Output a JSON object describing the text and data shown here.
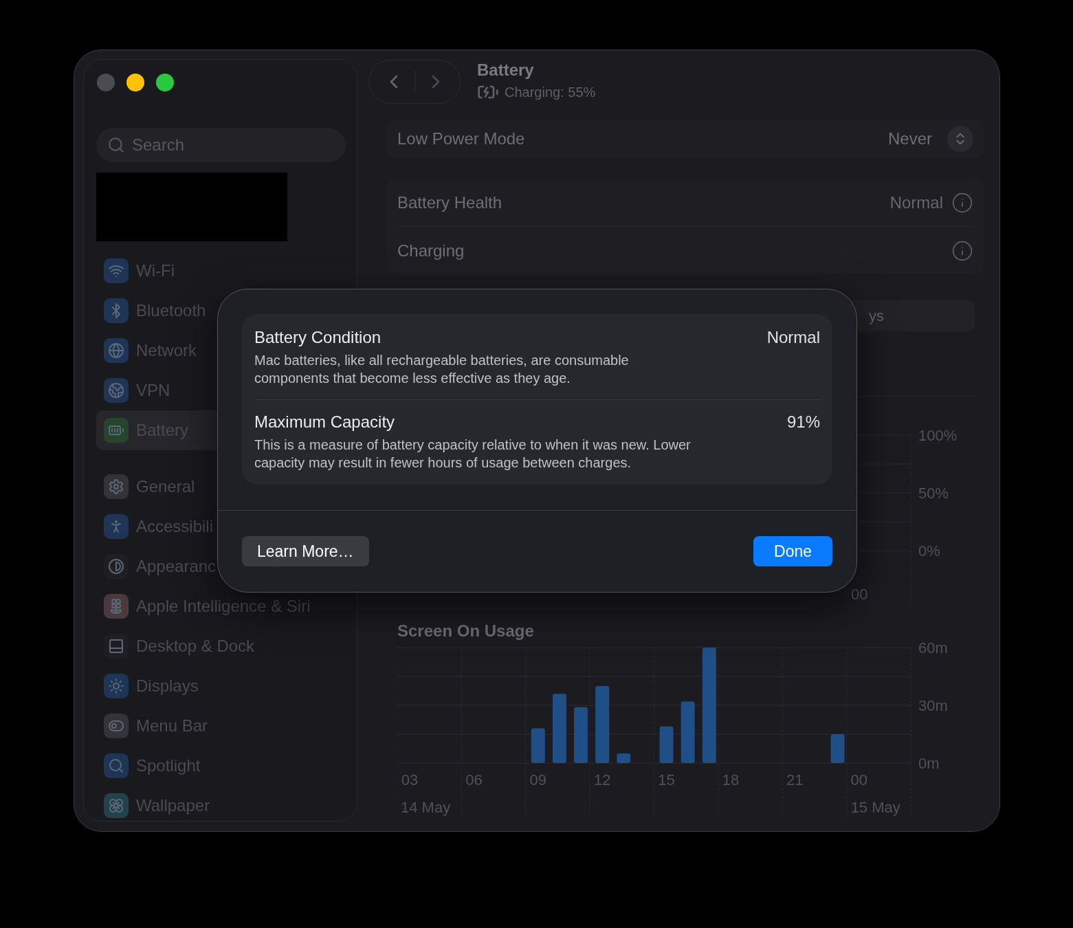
{
  "sidebar": {
    "search": {
      "placeholder": "Search"
    },
    "groups": [
      {
        "items": [
          {
            "label": "Wi-Fi",
            "selected": false
          },
          {
            "label": "Bluetooth",
            "selected": false
          },
          {
            "label": "Network",
            "selected": false
          },
          {
            "label": "VPN",
            "selected": false
          },
          {
            "label": "Battery",
            "selected": true
          }
        ]
      },
      {
        "items": [
          {
            "label": "General",
            "selected": false
          },
          {
            "label": "Accessibili",
            "selected": false
          },
          {
            "label": "Appearanc",
            "selected": false
          },
          {
            "label": "Apple Intelligence & Siri",
            "selected": false
          },
          {
            "label": "Desktop & Dock",
            "selected": false
          },
          {
            "label": "Displays",
            "selected": false
          },
          {
            "label": "Menu Bar",
            "selected": false
          },
          {
            "label": "Spotlight",
            "selected": false
          },
          {
            "label": "Wallpaper",
            "selected": false
          }
        ]
      }
    ]
  },
  "header": {
    "title": "Battery",
    "status": "Charging: 55%"
  },
  "cards": [
    {
      "rows": [
        {
          "kind": "popup",
          "label": "Low Power Mode",
          "value": "Never"
        }
      ]
    },
    {
      "rows": [
        {
          "kind": "info",
          "label": "Battery Health",
          "value": "Normal"
        },
        {
          "kind": "info",
          "label": "Charging"
        }
      ]
    }
  ],
  "period_control": {
    "label": "ys"
  },
  "battery_level_chart": {
    "y_labels": [
      "100%",
      "50%",
      "0%"
    ],
    "x_labels": [
      "00"
    ]
  },
  "screen_on_usage": {
    "date_labels": [
      "14 May",
      "15 May"
    ],
    "chart_data": {
      "type": "bar",
      "title": "Screen On Usage",
      "x": [
        9,
        10,
        11,
        12,
        13,
        15,
        16,
        17,
        23
      ],
      "xlim": [
        2.42,
        26.42
      ],
      "values": [
        18,
        36,
        29,
        40,
        5,
        19,
        32,
        60,
        15
      ],
      "ylim": [
        0,
        60
      ],
      "yticks": [
        {
          "value": 0,
          "label": "0m"
        },
        {
          "value": 30,
          "label": "30m"
        },
        {
          "value": 60,
          "label": "60m"
        }
      ],
      "xticks": [
        {
          "value": 3,
          "label": "03"
        },
        {
          "value": 6,
          "label": "06"
        },
        {
          "value": 9,
          "label": "09"
        },
        {
          "value": 12,
          "label": "12"
        },
        {
          "value": 15,
          "label": "15"
        },
        {
          "value": 18,
          "label": "18"
        },
        {
          "value": 21,
          "label": "21"
        }
      ]
    },
    "midnight_label": "00"
  },
  "dialog": {
    "items": [
      {
        "title": "Battery Condition",
        "value": "Normal",
        "description": "Mac batteries, like all rechargeable batteries, are consumable components that become less effective as they age."
      },
      {
        "title": "Maximum Capacity",
        "value": "91%",
        "description": "This is a measure of battery capacity relative to when it was new. Lower capacity may result in fewer hours of usage between charges."
      }
    ],
    "buttons": [
      {
        "kind": "secondary",
        "label": "Learn More…"
      },
      {
        "kind": "primary",
        "label": "Done"
      }
    ]
  }
}
